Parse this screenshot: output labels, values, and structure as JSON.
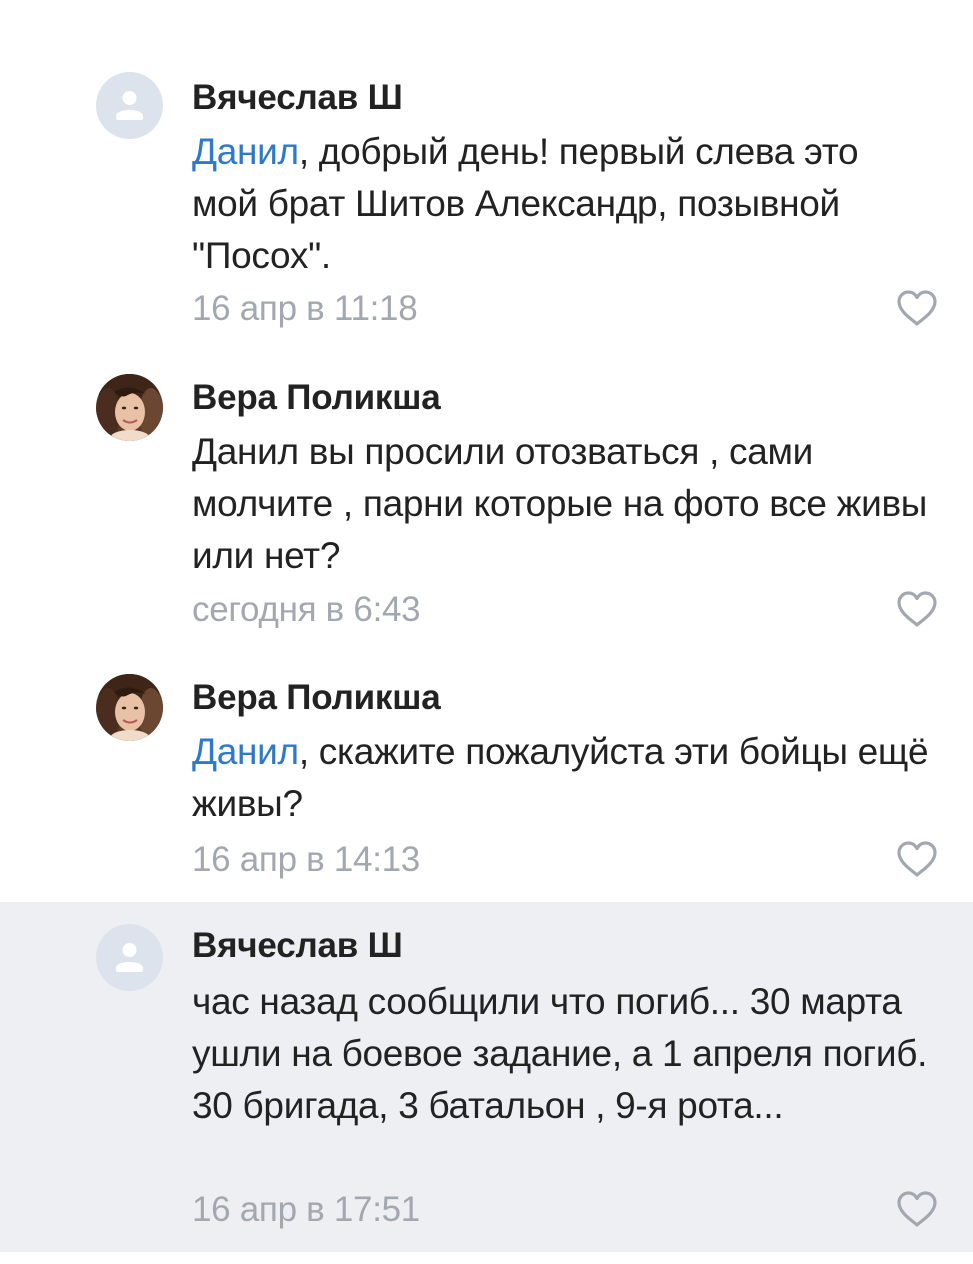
{
  "comments": [
    {
      "author": "Вячеслав Ш",
      "mention": "Данил",
      "text": ", добрый день! первый слева это мой брат Шитов Александр, позывной \"Посох\".",
      "time": "16 апр в 11:18",
      "avatar": "placeholder",
      "highlighted": false
    },
    {
      "author": "Вера Поликша",
      "mention": "",
      "text": "Данил вы просили отозваться , сами молчите , парни которые на фото все живы или нет?",
      "time": "сегодня в 6:43",
      "avatar": "photo",
      "highlighted": false
    },
    {
      "author": "Вера Поликша",
      "mention": "Данил",
      "text": ", скажите пожалуйста эти бойцы ещё живы?",
      "time": "16 апр в 14:13",
      "avatar": "photo",
      "highlighted": false
    },
    {
      "author": "Вячеслав Ш",
      "mention": "",
      "text": "час назад сообщили что погиб... 30 марта ушли на боевое задание, а 1 апреля погиб. 30 бригада, 3 батальон , 9-я рота...",
      "time": "16 апр в 17:51",
      "avatar": "placeholder",
      "highlighted": true
    }
  ],
  "icons": {
    "like": "heart-outline-icon",
    "placeholder_avatar": "user-icon"
  },
  "colors": {
    "mention": "#2f79c9",
    "timestamp": "#a3a8b0",
    "highlight_bg": "#eeeff2",
    "avatar_placeholder": "#dde3ec",
    "avatar_glyph": "#ffffff"
  }
}
